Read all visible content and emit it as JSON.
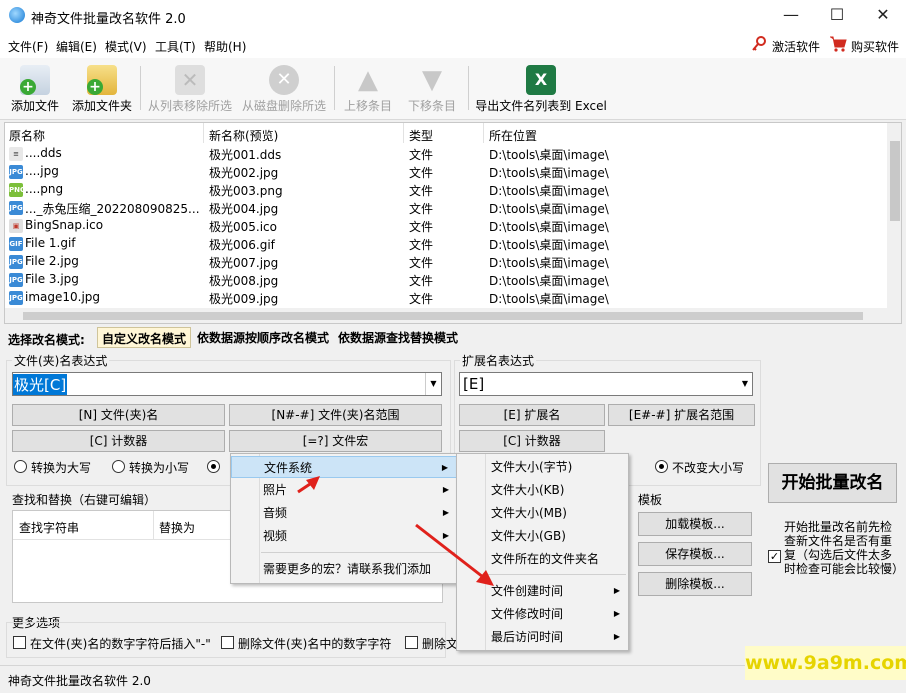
{
  "window": {
    "title": "神奇文件批量改名软件 2.0",
    "minimize": "—",
    "maximize": "☐",
    "close": "✕"
  },
  "menu": {
    "items": [
      "文件(F)",
      "编辑(E)",
      "模式(V)",
      "工具(T)",
      "帮助(H)"
    ],
    "activate": "激活软件",
    "buy": "购买软件"
  },
  "toolbar": {
    "add_file": "添加文件",
    "add_folder": "添加文件夹",
    "remove_list": "从列表移除所选",
    "delete_disk": "从磁盘删除所选",
    "move_up": "上移条目",
    "move_down": "下移条目",
    "export": "导出文件名列表到 Excel"
  },
  "file_list": {
    "headers": [
      "原名称",
      "新名称(预览)",
      "类型",
      "所在位置"
    ],
    "rows": [
      {
        "icon": "document-icon",
        "original": "....dds",
        "new": "极光001.dds",
        "type": "文件",
        "location": "D:\\tools\\桌面\\image\\"
      },
      {
        "icon": "jpg-icon",
        "original": "....jpg",
        "new": "极光002.jpg",
        "type": "文件",
        "location": "D:\\tools\\桌面\\image\\"
      },
      {
        "icon": "png-icon",
        "original": "....png",
        "new": "极光003.png",
        "type": "文件",
        "location": "D:\\tools\\桌面\\image\\"
      },
      {
        "icon": "jpg-icon",
        "original": "..._赤兔压缩_202208090825...",
        "new": "极光004.jpg",
        "type": "文件",
        "location": "D:\\tools\\桌面\\image\\"
      },
      {
        "icon": "ico-icon",
        "original": "BingSnap.ico",
        "new": "极光005.ico",
        "type": "文件",
        "location": "D:\\tools\\桌面\\image\\"
      },
      {
        "icon": "gif-icon",
        "original": "File 1.gif",
        "new": "极光006.gif",
        "type": "文件",
        "location": "D:\\tools\\桌面\\image\\"
      },
      {
        "icon": "jpg-icon",
        "original": "File 2.jpg",
        "new": "极光007.jpg",
        "type": "文件",
        "location": "D:\\tools\\桌面\\image\\"
      },
      {
        "icon": "jpg-icon",
        "original": "File 3.jpg",
        "new": "极光008.jpg",
        "type": "文件",
        "location": "D:\\tools\\桌面\\image\\"
      },
      {
        "icon": "jpg-icon",
        "original": "image10.jpg",
        "new": "极光009.jpg",
        "type": "文件",
        "location": "D:\\tools\\桌面\\image\\"
      }
    ]
  },
  "mode": {
    "label": "选择改名模式:",
    "tabs": [
      "自定义改名模式",
      "依数据源按顺序改名模式",
      "依数据源查找替换模式"
    ]
  },
  "name_expr": {
    "label": "文件(夹)名表达式",
    "value": "极光[C]",
    "btn_n": "[N] 文件(夹)名",
    "btn_range": "[N#-#] 文件(夹)名范围",
    "btn_counter": "[C] 计数器",
    "btn_macro": "[=?] 文件宏",
    "upper": "转换为大写",
    "lower": "转换为小写"
  },
  "ext_expr": {
    "label": "扩展名表达式",
    "value": "[E]",
    "btn_e": "[E] 扩展名",
    "btn_range": "[E#-#] 扩展名范围",
    "btn_counter": "[C] 计数器",
    "unchanged": "不改变大小写"
  },
  "find_replace": {
    "label": "查找和替换（右键可编辑）",
    "col_find": "查找字符串",
    "col_replace": "替换为"
  },
  "template": {
    "label": "模板",
    "load": "加载模板...",
    "save": "保存模板...",
    "delete": "删除模板..."
  },
  "start": {
    "button": "开始批量改名",
    "check_text": "开始批量改名前先检查新文件名是否有重复（勾选后文件太多时检查可能会比较慢）",
    "checked": true
  },
  "more": {
    "label": "更多选项",
    "opt1": "在文件(夹)名的数字字符后插入\"-\"",
    "opt2": "删除文件(夹)名中的数字字符",
    "opt3": "删除文"
  },
  "context_menu": {
    "items": [
      "文件系统",
      "照片",
      "音频",
      "视频"
    ],
    "more": "需要更多的宏？请联系我们添加"
  },
  "submenu": {
    "items": [
      "文件大小(字节)",
      "文件大小(KB)",
      "文件大小(MB)",
      "文件大小(GB)",
      "文件所在的文件夹名"
    ],
    "items2": [
      "文件创建时间",
      "文件修改时间",
      "最后访问时间"
    ]
  },
  "status": {
    "text": "神奇文件批量改名软件 2.0"
  },
  "watermark": "www.9a9m.com",
  "colors": {
    "arrow": "#e0211b",
    "accent": "#0078d7"
  }
}
